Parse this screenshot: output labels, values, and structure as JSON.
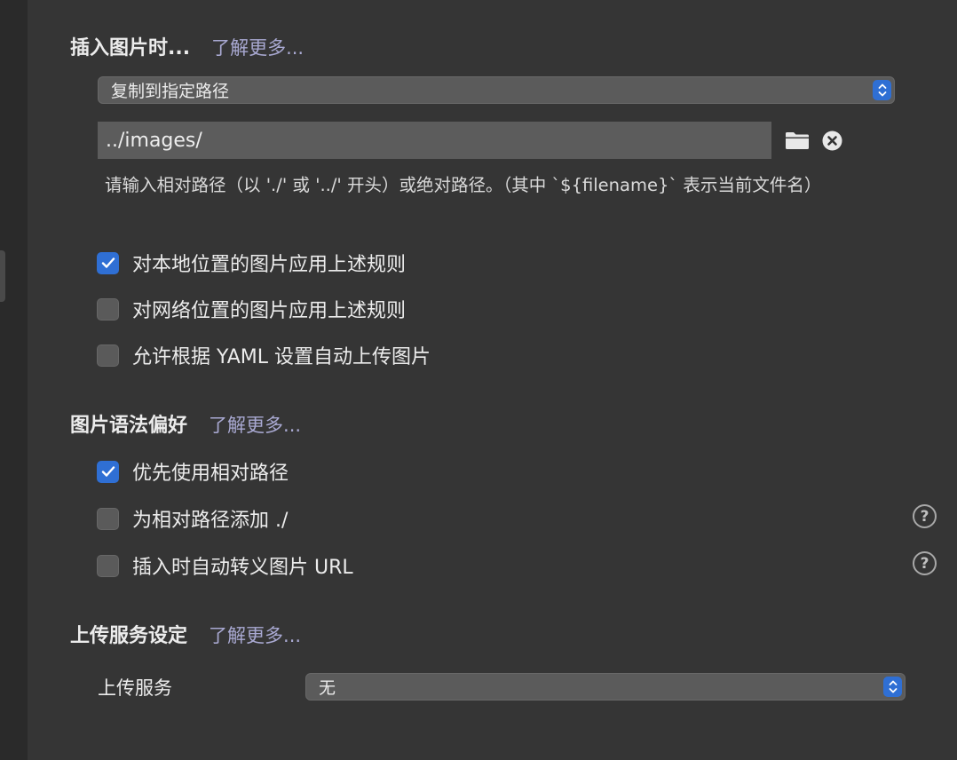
{
  "image_insert": {
    "title": "插入图片时...",
    "learn_more": "了解更多...",
    "action_select": "复制到指定路径",
    "path_value": "../images/",
    "help_text": "请输入相对路径（以 './' 或 '../' 开头）或绝对路径。（其中 `${filename}` 表示当前文件名）",
    "options": [
      {
        "label": "对本地位置的图片应用上述规则",
        "checked": true
      },
      {
        "label": "对网络位置的图片应用上述规则",
        "checked": false
      },
      {
        "label": "允许根据 YAML 设置自动上传图片",
        "checked": false
      }
    ]
  },
  "image_syntax": {
    "title": "图片语法偏好",
    "learn_more": "了解更多...",
    "options": [
      {
        "label": "优先使用相对路径",
        "checked": true
      },
      {
        "label": "为相对路径添加 ./",
        "checked": false
      },
      {
        "label": "插入时自动转义图片 URL",
        "checked": false
      }
    ]
  },
  "upload": {
    "title": "上传服务设定",
    "learn_more": "了解更多...",
    "service_label": "上传服务",
    "service_value": "无"
  },
  "icons": {
    "folder": "folder-icon",
    "clear": "clear-icon",
    "help": "help-icon",
    "checkmark": "checkmark-icon",
    "stepper": "select-stepper-icon"
  },
  "colors": {
    "accent": "#2f6fd4",
    "link": "#a9a9d2",
    "background": "#353535"
  }
}
